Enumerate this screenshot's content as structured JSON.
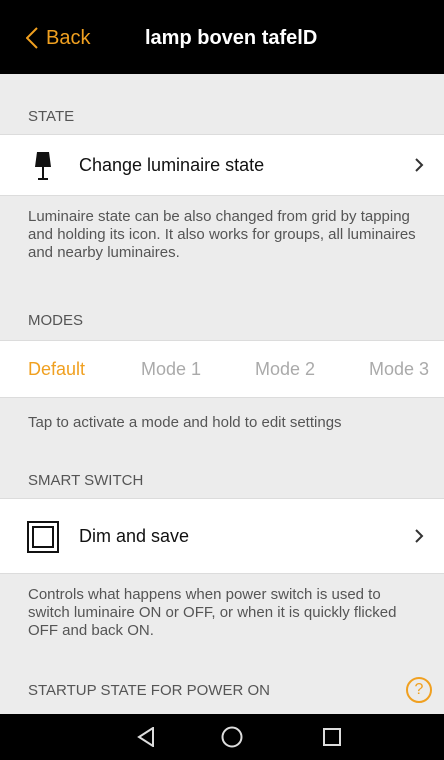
{
  "header": {
    "back_label": "Back",
    "title": "lamp boven tafelD"
  },
  "state": {
    "section_title": "STATE",
    "row_label": "Change luminaire state",
    "description": "Luminaire state can be also changed from grid by tapping and holding its icon. It also works for groups, all luminaires and nearby luminaires."
  },
  "modes": {
    "section_title": "MODES",
    "items": [
      {
        "label": "Default",
        "active": true
      },
      {
        "label": "Mode 1",
        "active": false
      },
      {
        "label": "Mode 2",
        "active": false
      },
      {
        "label": "Mode 3",
        "active": false
      }
    ],
    "hint": "Tap to activate a mode and hold to edit settings"
  },
  "smart_switch": {
    "section_title": "SMART SWITCH",
    "row_label": "Dim and save",
    "description": "Controls what happens when power switch is used to switch luminaire ON or OFF, or when it is quickly flicked OFF and back ON."
  },
  "startup": {
    "section_title": "STARTUP STATE FOR POWER ON",
    "help_glyph": "?"
  },
  "colors": {
    "accent": "#f0a020",
    "inactive_mode": "#aaaaaa"
  },
  "icons": [
    "chevron-left-icon",
    "lamp-icon",
    "chevron-right-icon",
    "square-frame-icon",
    "help-icon",
    "nav-back-icon",
    "nav-home-icon",
    "nav-recents-icon"
  ]
}
